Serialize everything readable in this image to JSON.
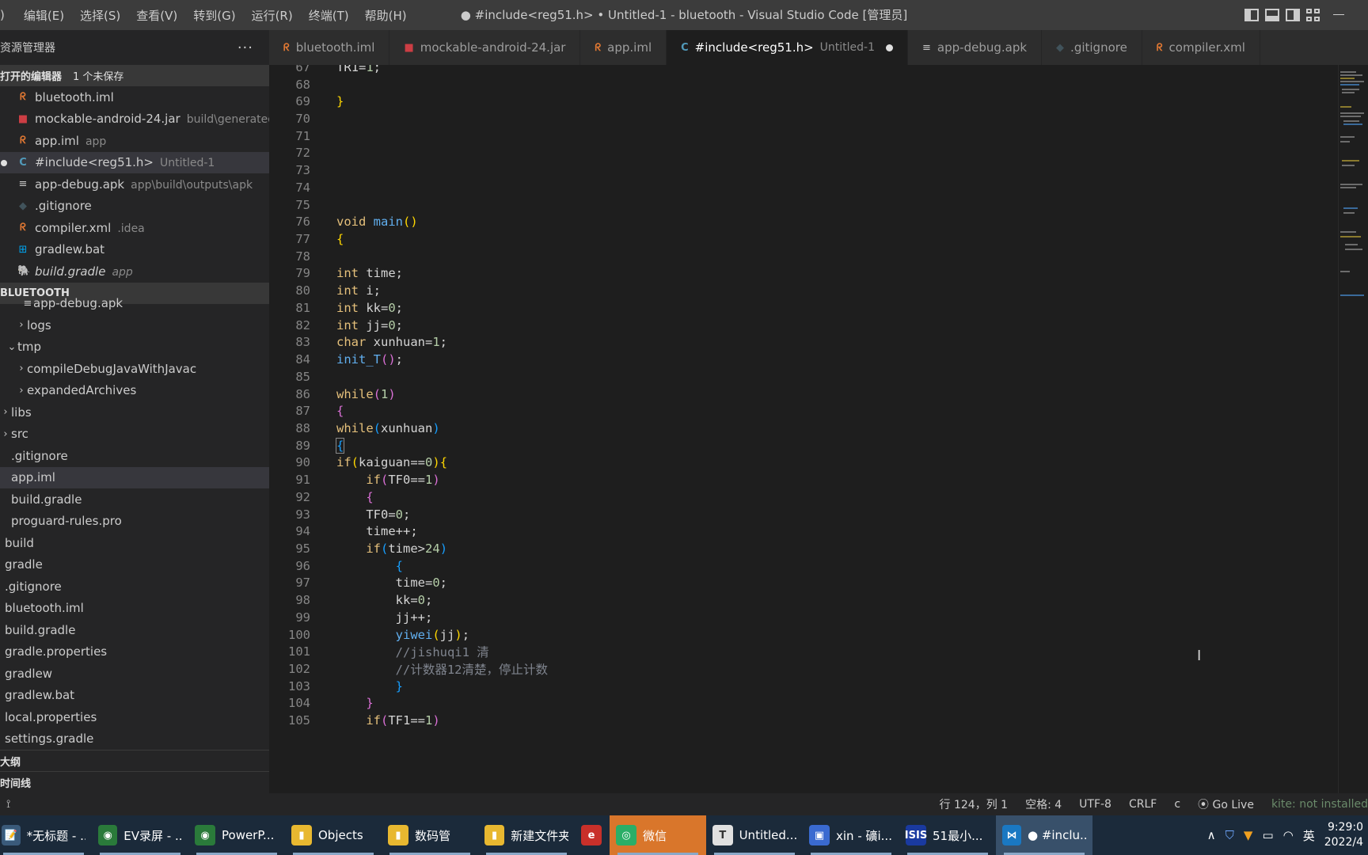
{
  "titlebar": {
    "menu": [
      "编辑(E)",
      "选择(S)",
      "查看(V)",
      "转到(G)",
      "运行(R)",
      "终端(T)",
      "帮助(H)"
    ],
    "menu_prefix": ")",
    "title": "● #include<reg51.h> • Untitled-1 - bluetooth - Visual Studio Code [管理员]"
  },
  "sidebar": {
    "title": "资源管理器",
    "more": "···",
    "open_editors": {
      "label": "打开的编辑器",
      "badge": "1 个未保存",
      "items": [
        {
          "icon": "rss-icon",
          "glyph": "ᖇ",
          "name": "bluetooth.iml",
          "desc": ""
        },
        {
          "icon": "jar-icon",
          "glyph": "■",
          "name": "mockable-android-24.jar",
          "desc": "build\\generated"
        },
        {
          "icon": "rss-icon",
          "glyph": "ᖇ",
          "name": "app.iml",
          "desc": "app"
        },
        {
          "icon": "c-file-icon",
          "glyph": "C",
          "name": "#include<reg51.h>",
          "desc": "Untitled-1"
        },
        {
          "icon": "lines-icon",
          "glyph": "≡",
          "name": "app-debug.apk",
          "desc": "app\\build\\outputs\\apk"
        },
        {
          "icon": "git-icon",
          "glyph": "◆",
          "name": ".gitignore",
          "desc": ""
        },
        {
          "icon": "rss-icon",
          "glyph": "ᖇ",
          "name": "compiler.xml",
          "desc": ".idea"
        },
        {
          "icon": "windows-icon",
          "glyph": "⊞",
          "name": "gradlew.bat",
          "desc": ""
        },
        {
          "icon": "gradle-icon",
          "glyph": "🐘",
          "name": "build.gradle",
          "desc": "app"
        }
      ]
    },
    "project": {
      "label": "BLUETOOTH",
      "items": [
        {
          "name": "app-debug.apk",
          "chev": "≡",
          "indent": 28
        },
        {
          "name": "logs",
          "chev": "›",
          "indent": 20
        },
        {
          "name": "tmp",
          "chev": "⌄",
          "indent": 8
        },
        {
          "name": "compileDebugJavaWithJavac",
          "chev": "›",
          "indent": 20
        },
        {
          "name": "expandedArchives",
          "chev": "›",
          "indent": 20
        },
        {
          "name": "libs",
          "chev": "›",
          "indent": 0
        },
        {
          "name": "src",
          "chev": "›",
          "indent": 0
        },
        {
          "name": ".gitignore",
          "chev": "",
          "indent": 14
        },
        {
          "name": "app.iml",
          "chev": "",
          "indent": 14
        },
        {
          "name": "build.gradle",
          "chev": "",
          "indent": 14
        },
        {
          "name": "proguard-rules.pro",
          "chev": "",
          "indent": 14
        },
        {
          "name": "build",
          "chev": "",
          "indent": 6
        },
        {
          "name": "gradle",
          "chev": "",
          "indent": 6
        },
        {
          "name": ".gitignore",
          "chev": "",
          "indent": 6
        },
        {
          "name": "bluetooth.iml",
          "chev": "",
          "indent": 6
        },
        {
          "name": "build.gradle",
          "chev": "",
          "indent": 6
        },
        {
          "name": "gradle.properties",
          "chev": "",
          "indent": 6
        },
        {
          "name": "gradlew",
          "chev": "",
          "indent": 6
        },
        {
          "name": "gradlew.bat",
          "chev": "",
          "indent": 6
        },
        {
          "name": "local.properties",
          "chev": "",
          "indent": 6
        },
        {
          "name": "settings.gradle",
          "chev": "",
          "indent": 6
        }
      ]
    },
    "outline_label": "大纲",
    "timeline_label": "时间线"
  },
  "tabs": [
    {
      "icon": "rss-icon",
      "glyph": "ᖇ",
      "name": "bluetooth.iml",
      "desc": "",
      "active": false
    },
    {
      "icon": "jar-icon",
      "glyph": "■",
      "name": "mockable-android-24.jar",
      "desc": "",
      "active": false
    },
    {
      "icon": "rss-icon",
      "glyph": "ᖇ",
      "name": "app.iml",
      "desc": "",
      "active": false
    },
    {
      "icon": "c-file-icon",
      "glyph": "C",
      "name": "#include<reg51.h>",
      "desc": "Untitled-1",
      "active": true
    },
    {
      "icon": "lines-icon",
      "glyph": "≡",
      "name": "app-debug.apk",
      "desc": "",
      "active": false
    },
    {
      "icon": "git-icon",
      "glyph": "◆",
      "name": ".gitignore",
      "desc": "",
      "active": false
    },
    {
      "icon": "rss-icon",
      "glyph": "ᖇ",
      "name": "compiler.xml",
      "desc": "",
      "active": false
    }
  ],
  "editor": {
    "lines": [
      {
        "n": "67",
        "html": "TR1=<span class=\"num\">1</span>;"
      },
      {
        "n": "68",
        "html": ""
      },
      {
        "n": "69",
        "html": "<span class=\"br1\">}</span>"
      },
      {
        "n": "70",
        "html": ""
      },
      {
        "n": "71",
        "html": ""
      },
      {
        "n": "72",
        "html": ""
      },
      {
        "n": "73",
        "html": ""
      },
      {
        "n": "74",
        "html": ""
      },
      {
        "n": "75",
        "html": ""
      },
      {
        "n": "76",
        "html": "<span class=\"ctl\" style=\"color:#e5c07b\">void</span> <span class=\"br3\" style=\"color:#61afef\">main</span><span class=\"br1\">()</span>"
      },
      {
        "n": "77",
        "html": "<span class=\"br1\">{</span>"
      },
      {
        "n": "78",
        "html": ""
      },
      {
        "n": "79",
        "html": "<span style=\"color:#e5c07b\">int</span> time;"
      },
      {
        "n": "80",
        "html": "<span style=\"color:#e5c07b\">int</span> i;"
      },
      {
        "n": "81",
        "html": "<span style=\"color:#e5c07b\">int</span> kk=<span class=\"num\">0</span>;"
      },
      {
        "n": "82",
        "html": "<span style=\"color:#e5c07b\">int</span> jj=<span class=\"num\">0</span>;"
      },
      {
        "n": "83",
        "html": "<span style=\"color:#e5c07b\">char</span> xunhuan=<span class=\"num\">1</span>;"
      },
      {
        "n": "84",
        "html": "<span style=\"color:#61afef\">init_T</span><span class=\"br2\">()</span>;"
      },
      {
        "n": "85",
        "html": ""
      },
      {
        "n": "86",
        "html": "<span style=\"color:#e5c07b\">while</span><span class=\"br2\">(</span><span class=\"num\">1</span><span class=\"br2\">)</span>"
      },
      {
        "n": "87",
        "html": "<span class=\"br2\">{</span>"
      },
      {
        "n": "88",
        "html": "<span style=\"color:#e5c07b\">while</span><span class=\"br3\">(</span>xunhuan<span class=\"br3\">)</span>"
      },
      {
        "n": "89",
        "html": "<span class=\"br3 cursor-box\">{</span>"
      },
      {
        "n": "90",
        "html": "<span style=\"color:#e5c07b\">if</span><span class=\"br1\">(</span>kaiguan==<span class=\"num\">0</span><span class=\"br1\">){</span>"
      },
      {
        "n": "91",
        "html": "    <span style=\"color:#e5c07b\">if</span><span class=\"br2\">(</span>TF0==<span class=\"num\">1</span><span class=\"br2\">)</span>"
      },
      {
        "n": "92",
        "html": "    <span class=\"br2\">{</span>"
      },
      {
        "n": "93",
        "html": "    TF0=<span class=\"num\">0</span>;"
      },
      {
        "n": "94",
        "html": "    time++;"
      },
      {
        "n": "95",
        "html": "    <span style=\"color:#e5c07b\">if</span><span class=\"br3\">(</span>time&gt;<span class=\"num\">24</span><span class=\"br3\">)</span>"
      },
      {
        "n": "96",
        "html": "        <span class=\"br3\">{</span>"
      },
      {
        "n": "97",
        "html": "        time=<span class=\"num\">0</span>;"
      },
      {
        "n": "98",
        "html": "        kk=<span class=\"num\">0</span>;"
      },
      {
        "n": "99",
        "html": "        jj++;"
      },
      {
        "n": "100",
        "html": "        <span style=\"color:#61afef\">yiwei</span><span class=\"br1\">(</span>jj<span class=\"br1\">)</span>;"
      },
      {
        "n": "101",
        "html": "        <span class=\"cm\" style=\"color:#7f848e\">//jishuqi1 清</span>"
      },
      {
        "n": "102",
        "html": "        <span class=\"cm\" style=\"color:#7f848e\">//计数器12清楚，停止计数</span>"
      },
      {
        "n": "103",
        "html": "        <span class=\"br3\">}</span>"
      },
      {
        "n": "104",
        "html": "    <span class=\"br2\">}</span>"
      },
      {
        "n": "105",
        "html": "    <span style=\"color:#e5c07b\">if</span><span class=\"br2\">(</span>TF1==<span class=\"num\">1</span><span class=\"br2\">)</span>"
      }
    ]
  },
  "statusbar": {
    "branch_glyph": "⟟",
    "position": "行 124，列 1",
    "spaces": "空格: 4",
    "encoding": "UTF-8",
    "eol": "CRLF",
    "language": "c",
    "golive": "Go Live",
    "kite": "kite: not installed"
  },
  "taskbar": {
    "items": [
      {
        "name": "notepad-task",
        "label": "*无标题 - ...",
        "glyph": "📝",
        "bg": "#3a5a7a",
        "running": true
      },
      {
        "name": "chrome-ev-task",
        "label": "EV录屏 - ...",
        "glyph": "◉",
        "bg": "#2a7a3a",
        "running": true
      },
      {
        "name": "chrome-ppt-task",
        "label": "PowerP...",
        "glyph": "◉",
        "bg": "#2a7a3a",
        "running": true
      },
      {
        "name": "folder-objects-task",
        "label": "Objects",
        "glyph": "▮",
        "bg": "#e8b830",
        "running": true
      },
      {
        "name": "folder-shumaguan-task",
        "label": "数码管",
        "glyph": "▮",
        "bg": "#e8b830",
        "running": true
      },
      {
        "name": "folder-new-task",
        "label": "新建文件夹",
        "glyph": "▮",
        "bg": "#e8b830",
        "running": true
      },
      {
        "name": "app-red-task",
        "label": "",
        "glyph": "e",
        "bg": "#c8302a",
        "running": false
      },
      {
        "name": "wechat-task",
        "label": "微信",
        "glyph": "◎",
        "bg": "#2aae67",
        "running": true
      },
      {
        "name": "typora-task",
        "label": "Untitled...",
        "glyph": "T",
        "bg": "#e0e0e0",
        "running": true
      },
      {
        "name": "xin-task",
        "label": "xin - 礦i...",
        "glyph": "▣",
        "bg": "#3a6ad0",
        "running": true
      },
      {
        "name": "isis-task",
        "label": "51最小...",
        "glyph": "ISIS",
        "bg": "#1a3aa0",
        "running": true
      },
      {
        "name": "vscode-task",
        "label": "● #inclu...",
        "glyph": "⋈",
        "bg": "#1a78c2",
        "running": true
      }
    ],
    "ime": "英",
    "time": "9:29:0",
    "date": "2022/4"
  }
}
